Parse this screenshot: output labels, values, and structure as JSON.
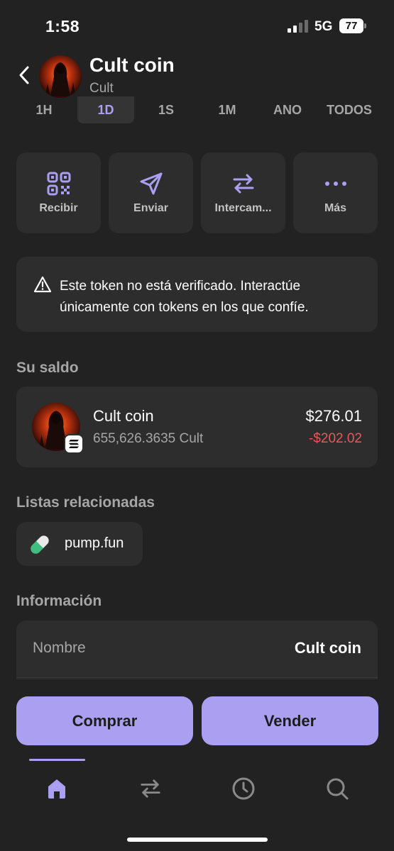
{
  "status_bar": {
    "time": "1:58",
    "network": "5G",
    "battery": "77"
  },
  "header": {
    "title": "Cult coin",
    "subtitle": "Cult"
  },
  "ranges": [
    "1H",
    "1D",
    "1S",
    "1M",
    "ANO",
    "TODOS"
  ],
  "ranges_active": "1D",
  "actions": [
    {
      "label": "Recibir",
      "icon": "qr-code-icon"
    },
    {
      "label": "Enviar",
      "icon": "send-icon"
    },
    {
      "label": "Intercam...",
      "icon": "swap-icon"
    },
    {
      "label": "Más",
      "icon": "more-icon"
    }
  ],
  "warning": {
    "text": "Este token no está verificado. Interactúe únicamente con tokens en los que confíe.",
    "icon": "warning-triangle-icon"
  },
  "balance_section": {
    "title": "Su saldo",
    "token_name": "Cult coin",
    "amount": "655,626.3635 Cult",
    "usd_value": "$276.01",
    "change": "-$202.02",
    "chain_icon": "solana-icon"
  },
  "related_section": {
    "title": "Listas relacionadas",
    "chip_label": "pump.fun",
    "chip_icon": "pill-icon"
  },
  "info_section": {
    "title": "Información",
    "rows": [
      {
        "key": "Nombre",
        "value": "Cult coin"
      }
    ]
  },
  "buttons": {
    "buy": "Comprar",
    "sell": "Vender"
  },
  "tabbar": {
    "items": [
      "home-icon",
      "swap-icon",
      "history-icon",
      "search-icon"
    ],
    "active": "home-icon"
  },
  "colors": {
    "accent": "#ab9ff2",
    "negative": "#eb5757",
    "background": "#222222",
    "card": "#2d2d2d"
  }
}
